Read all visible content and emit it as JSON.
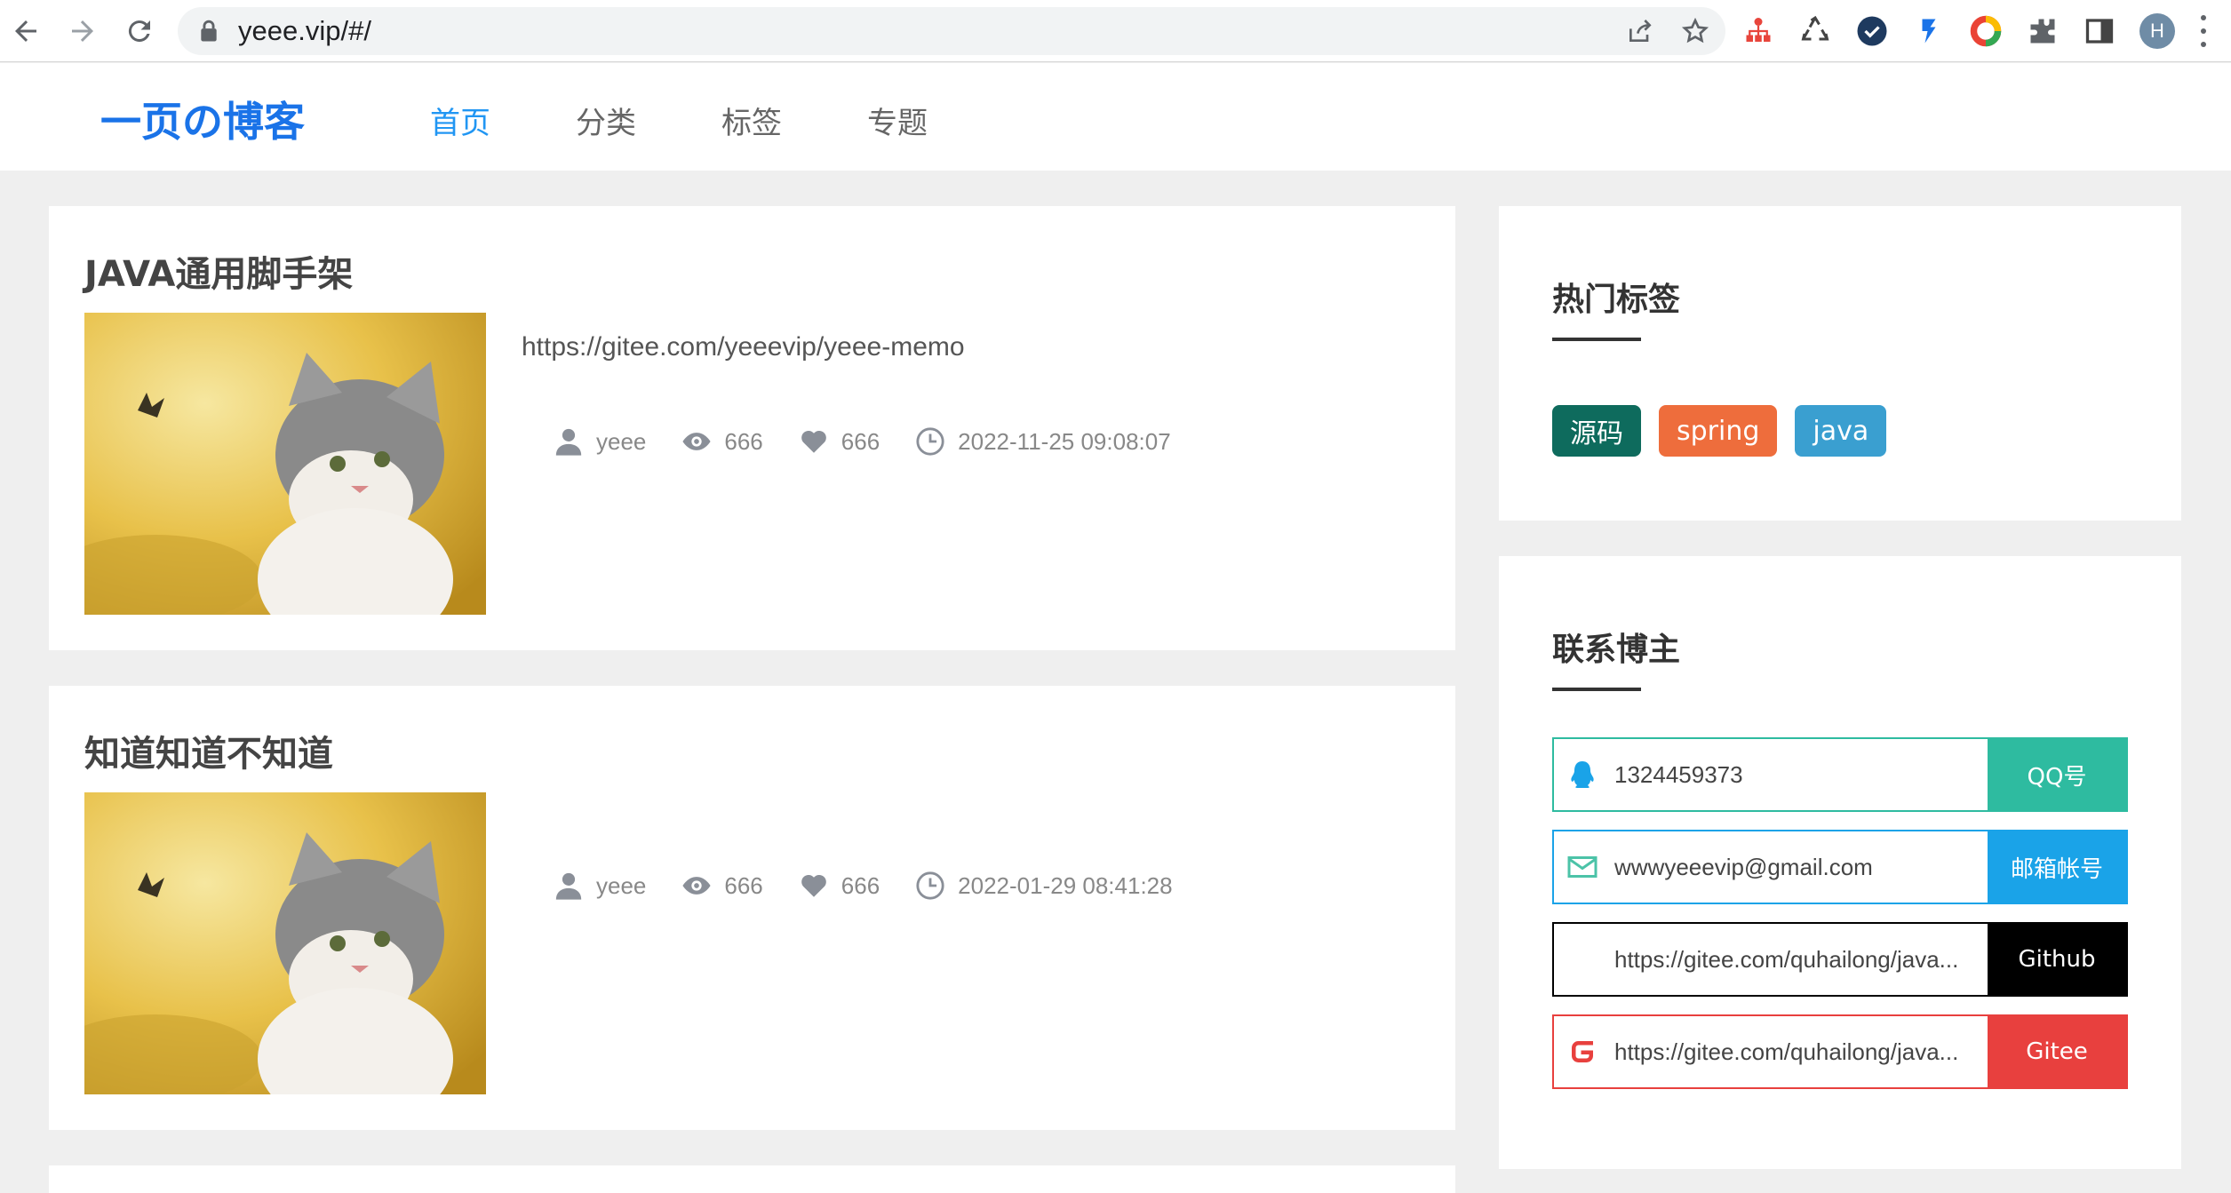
{
  "browser": {
    "url": "yeee.vip/#/",
    "profile_initial": "H"
  },
  "site": {
    "logo": "一页の博客",
    "nav": [
      {
        "label": "首页",
        "active": true
      },
      {
        "label": "分类",
        "active": false
      },
      {
        "label": "标签",
        "active": false
      },
      {
        "label": "专题",
        "active": false
      }
    ]
  },
  "posts": [
    {
      "title": "JAVA通用脚手架",
      "link": "https://gitee.com/yeeevip/yeee-memo",
      "author": "yeee",
      "views": "666",
      "likes": "666",
      "date": "2022-11-25 09:08:07"
    },
    {
      "title": "知道知道不知道",
      "link": "",
      "author": "yeee",
      "views": "666",
      "likes": "666",
      "date": "2022-01-29 08:41:28"
    }
  ],
  "sidebar": {
    "hot_tags_title": "热门标签",
    "tags": [
      {
        "label": "源码",
        "color": "#0e6b5d"
      },
      {
        "label": "spring",
        "color": "#ee6d3c"
      },
      {
        "label": "java",
        "color": "#3a9fd0"
      }
    ],
    "contact_title": "联系博主",
    "contacts": [
      {
        "value": "1324459373",
        "button": "QQ号",
        "color": "#2ebba0",
        "icon": "qq-icon"
      },
      {
        "value": "wwwyeeevip@gmail.com",
        "button": "邮箱帐号",
        "color": "#1aa3e8",
        "icon": "mail-icon"
      },
      {
        "value": "https://gitee.com/quhailong/java...",
        "button": "Github",
        "color": "#000000",
        "icon": "github-icon"
      },
      {
        "value": "https://gitee.com/quhailong/java...",
        "button": "Gitee",
        "color": "#e8403e",
        "icon": "gitee-icon"
      }
    ]
  }
}
